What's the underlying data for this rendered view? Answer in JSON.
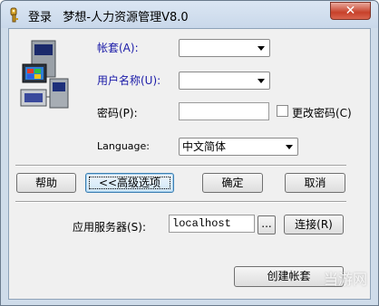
{
  "window": {
    "title": "登录   梦想-人力资源管理V8.0",
    "close_label": "✕"
  },
  "form": {
    "account_label": "帐套(A):",
    "account_value": "",
    "username_label": "用户名称(U):",
    "username_value": "",
    "password_label": "密码(P):",
    "password_value": "",
    "change_password_label": "更改密码(C)",
    "change_password_checked": false,
    "language_label": "Language:",
    "language_value": "中文简体"
  },
  "buttons": {
    "help": "帮助",
    "advanced": "<<高级选项",
    "ok": "确定",
    "cancel": "取消",
    "browse": "...",
    "connect": "连接(R)",
    "create_account": "创建帐套"
  },
  "server": {
    "label": "应用服务器(S):",
    "value": "localhost"
  },
  "watermark": "当游网",
  "icons": {
    "app": "key-icon",
    "logo": "computers-network-icon"
  }
}
